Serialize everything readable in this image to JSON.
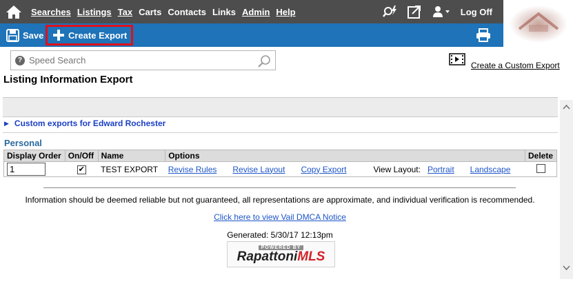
{
  "nav": {
    "items": [
      {
        "label": "Searches",
        "u": "S"
      },
      {
        "label": "Listings",
        "u": "L"
      },
      {
        "label": "Tax",
        "u": "T"
      },
      {
        "label": "Carts",
        "u": "r"
      },
      {
        "label": "Contacts",
        "u": "c"
      },
      {
        "label": "Links",
        "u": "n"
      },
      {
        "label": "Admin",
        "u": "A"
      },
      {
        "label": "Help",
        "u": "H"
      }
    ],
    "searches": "Searches",
    "listings": "Listings",
    "tax": "Tax",
    "carts": "Carts",
    "contacts": "Contacts",
    "links": "Links",
    "admin": "Admin",
    "help": "Help",
    "logoff": "Log Off"
  },
  "toolbar": {
    "save": "Save",
    "create_export": "Create Export"
  },
  "search": {
    "placeholder": "Speed Search"
  },
  "custom_export_link": "Create a Custom Export",
  "page_title": "Listing Information Export",
  "custom_for": "Custom exports for Edward Rochester",
  "section": "Personal",
  "table": {
    "headers": {
      "display_order": "Display Order",
      "on_off": "On/Off",
      "name": "Name",
      "options": "Options",
      "delete": "Delete"
    },
    "rows": [
      {
        "display_order": "1",
        "on": true,
        "name": "TEST EXPORT",
        "revise_rules": "Revise Rules",
        "revise_layout": "Revise Layout",
        "copy_export": "Copy Export",
        "view_layout_label": "View Layout:",
        "portrait": "Portrait",
        "landscape": "Landscape",
        "delete": false
      }
    ]
  },
  "footer": {
    "disclaimer": "Information should be deemed reliable but not guaranteed, all representations are approximate, and individual verification is recommended.",
    "dmca": "Click here to view Vail DMCA Notice",
    "generated": "Generated: 5/30/17 12:13pm",
    "powered_by": "POWERED BY",
    "brand_black": "Rapattoni",
    "brand_red": "MLS"
  },
  "colors": {
    "nav_bg": "#4d4d4d",
    "toolbar_bg": "#1e73b9",
    "highlight_border": "#e0101a",
    "link": "#1c55c8",
    "section_title": "#2a6a9e"
  }
}
